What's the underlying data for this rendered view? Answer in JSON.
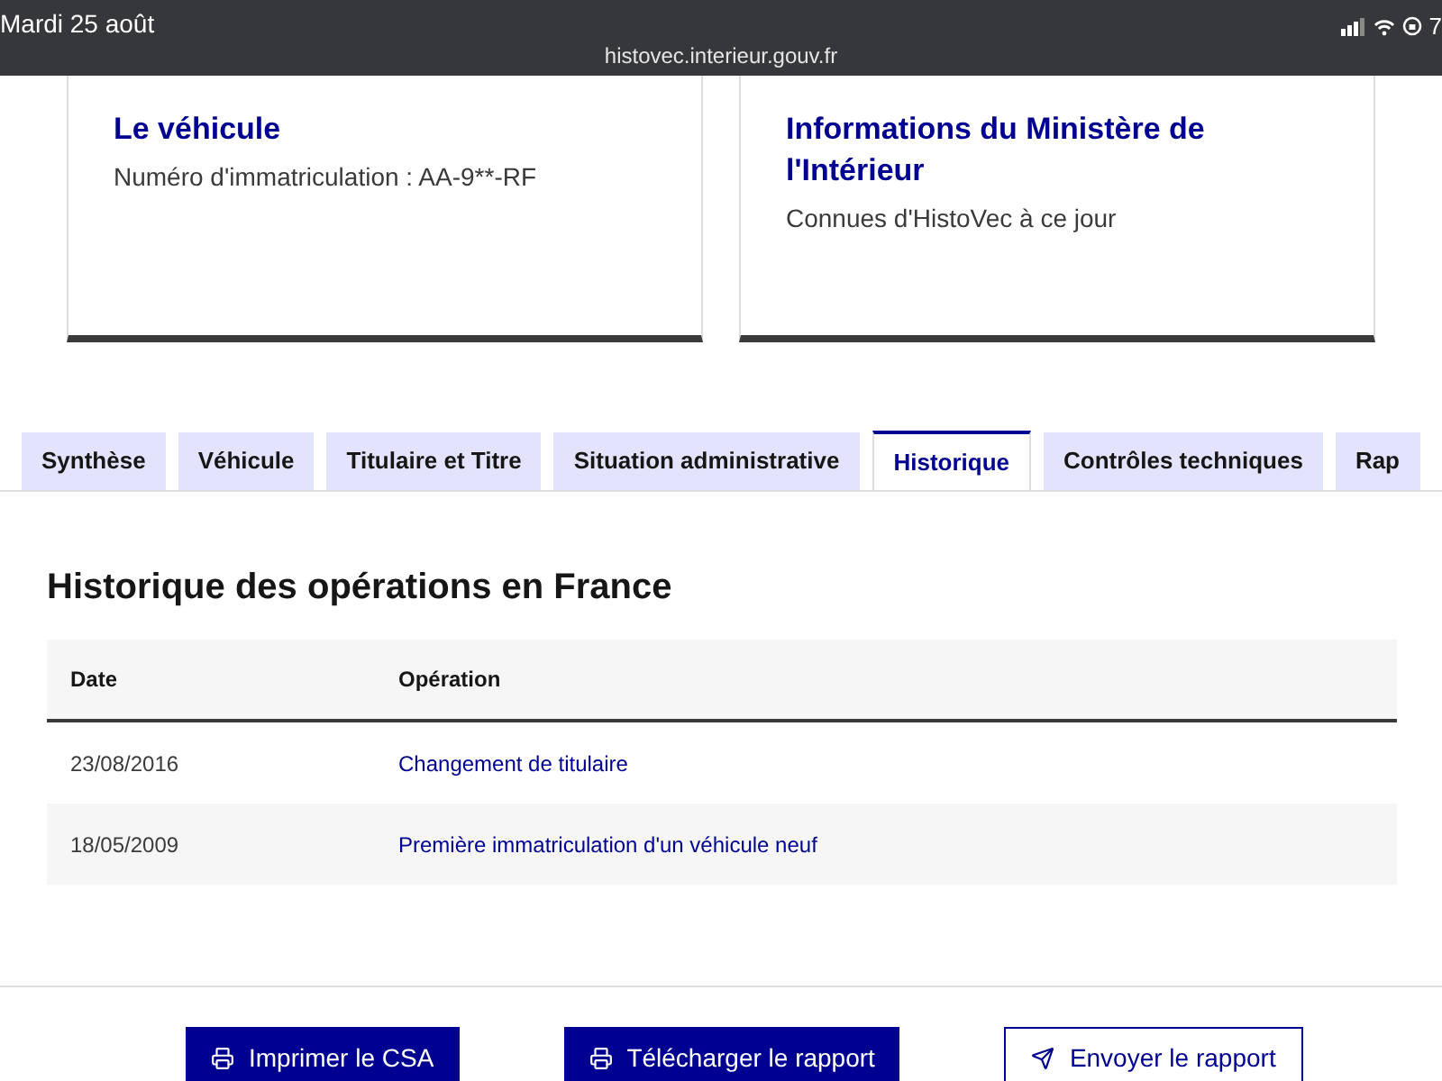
{
  "status_bar": {
    "date": "Mardi 25 août",
    "url": "histovec.interieur.gouv.fr",
    "battery": "7"
  },
  "cards": [
    {
      "title": "Le véhicule",
      "subtitle": "Numéro d'immatriculation : AA-9**-RF"
    },
    {
      "title": "Informations du Ministère de l'Intérieur",
      "subtitle": "Connues d'HistoVec à ce jour"
    }
  ],
  "tabs": [
    {
      "label": "Synthèse",
      "selected": false
    },
    {
      "label": "Véhicule",
      "selected": false
    },
    {
      "label": "Titulaire et Titre",
      "selected": false
    },
    {
      "label": "Situation administrative",
      "selected": false
    },
    {
      "label": "Historique",
      "selected": true
    },
    {
      "label": "Contrôles techniques",
      "selected": false
    },
    {
      "label": "Rap",
      "selected": false
    }
  ],
  "panel": {
    "title": "Historique des opérations en France",
    "table": {
      "columns": [
        "Date",
        "Opération"
      ],
      "rows": [
        {
          "date": "23/08/2016",
          "operation": "Changement de titulaire"
        },
        {
          "date": "18/05/2009",
          "operation": "Première immatriculation d'un véhicule neuf"
        }
      ]
    }
  },
  "buttons": [
    {
      "label": "Imprimer le CSA",
      "kind": "primary"
    },
    {
      "label": "Télécharger le rapport",
      "kind": "primary"
    },
    {
      "label": "Envoyer le rapport",
      "kind": "secondary"
    }
  ]
}
